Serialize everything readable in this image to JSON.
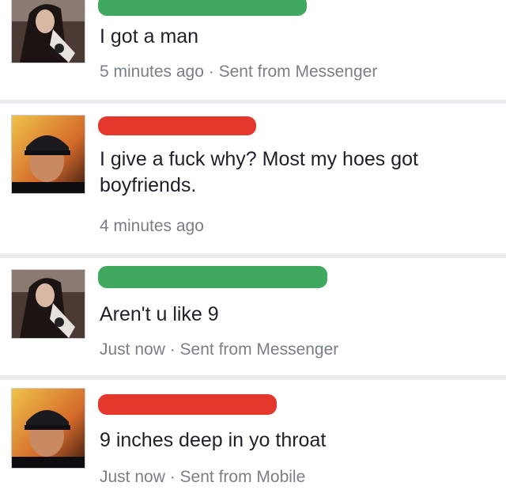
{
  "colors": {
    "redact_green": "#41a85f",
    "redact_red": "#e3382b",
    "text": "#1d2129",
    "meta": "#7a7f87"
  },
  "messages": [
    {
      "avatar": "woman-selfie-avatar",
      "redaction": "green",
      "text": "I got a man",
      "meta": "5 minutes ago · Sent from Messenger"
    },
    {
      "avatar": "boy-cap-avatar",
      "redaction": "red",
      "text": "I give a fuck why? Most my hoes got boyfriends.",
      "meta": "4 minutes ago"
    },
    {
      "avatar": "woman-selfie-avatar",
      "redaction": "green",
      "text": "Aren't u like 9",
      "meta": "Just now · Sent from Messenger"
    },
    {
      "avatar": "boy-cap-avatar",
      "redaction": "red",
      "text": "9 inches deep in yo throat",
      "meta": "Just now · Sent from Mobile"
    }
  ]
}
